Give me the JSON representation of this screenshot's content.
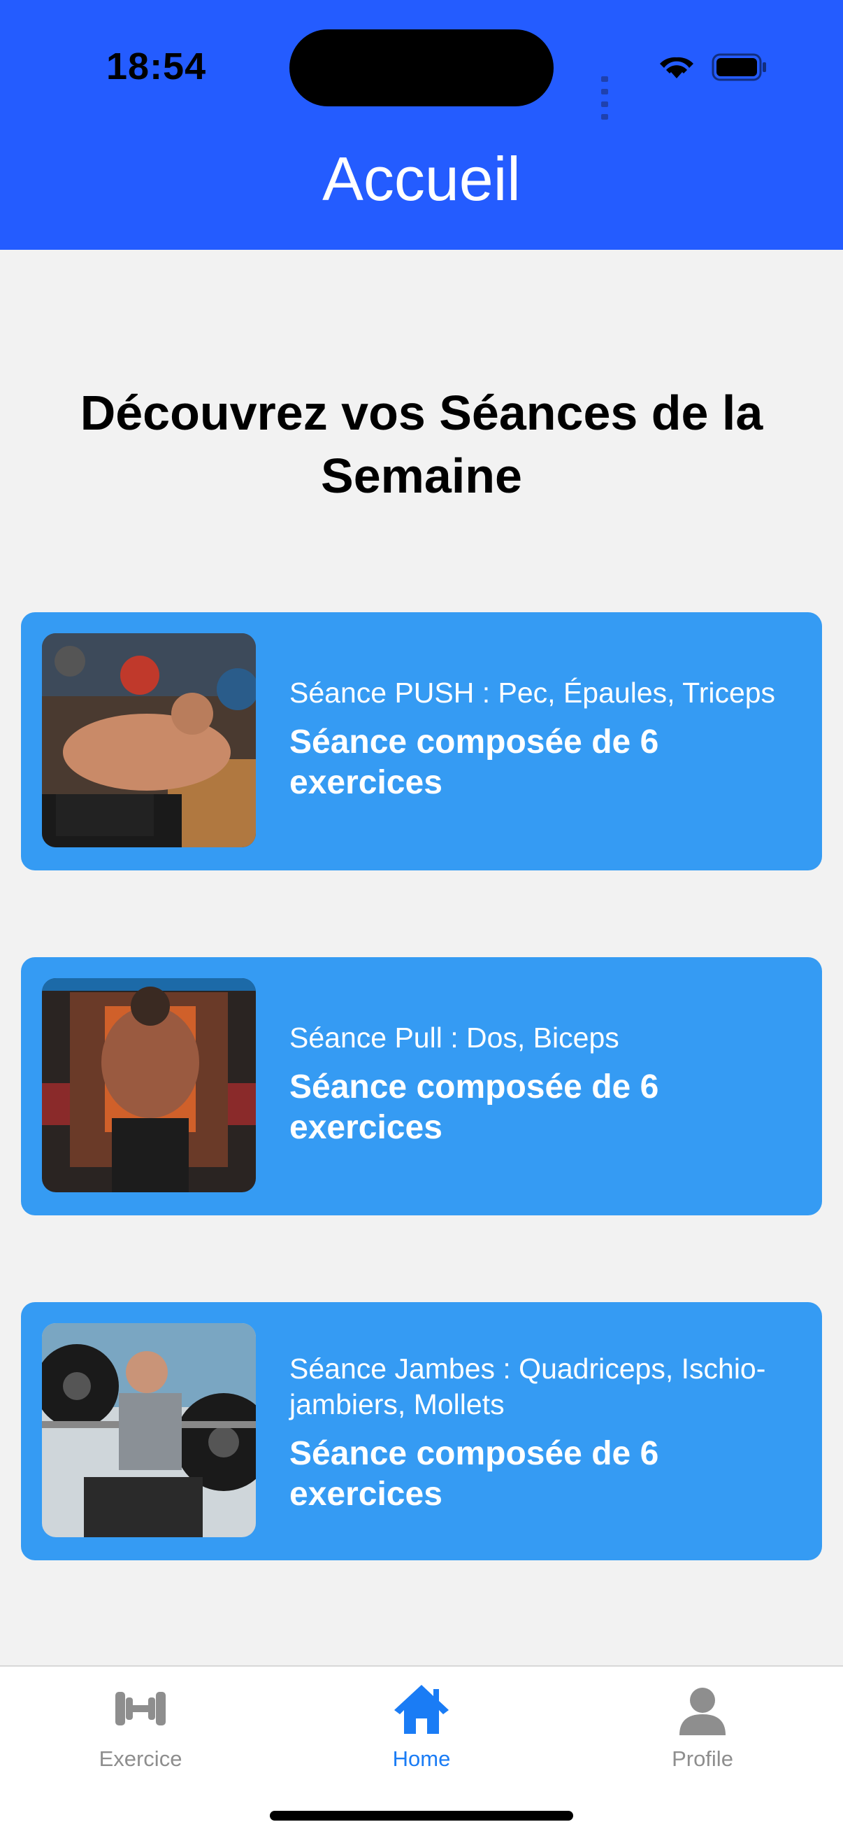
{
  "status_bar": {
    "time": "18:54"
  },
  "header": {
    "title": "Accueil"
  },
  "main": {
    "heading": "Découvrez vos Séances de la Semaine",
    "cards": [
      {
        "subtitle": "Séance PUSH : Pec, Épaules, Triceps",
        "title": "Séance composée de 6 exercices",
        "image": "bench-press-photo"
      },
      {
        "subtitle": "Séance Pull : Dos, Biceps",
        "title": "Séance composée de 6 exercices",
        "image": "pull-up-photo"
      },
      {
        "subtitle": "Séance Jambes : Quadriceps, Ischio-jambiers, Mollets",
        "title": "Séance composée de 6 exercices",
        "image": "front-squat-photo"
      }
    ]
  },
  "tabbar": {
    "tabs": [
      {
        "label": "Exercice",
        "icon": "dumbbell-icon",
        "active": false
      },
      {
        "label": "Home",
        "icon": "house-icon",
        "active": true
      },
      {
        "label": "Profile",
        "icon": "person-icon",
        "active": false
      }
    ]
  },
  "colors": {
    "header": "#245cff",
    "card": "#359bf3",
    "active_tab": "#1a7cf5",
    "inactive_tab": "#8e8e8e",
    "background": "#f2f2f2"
  }
}
